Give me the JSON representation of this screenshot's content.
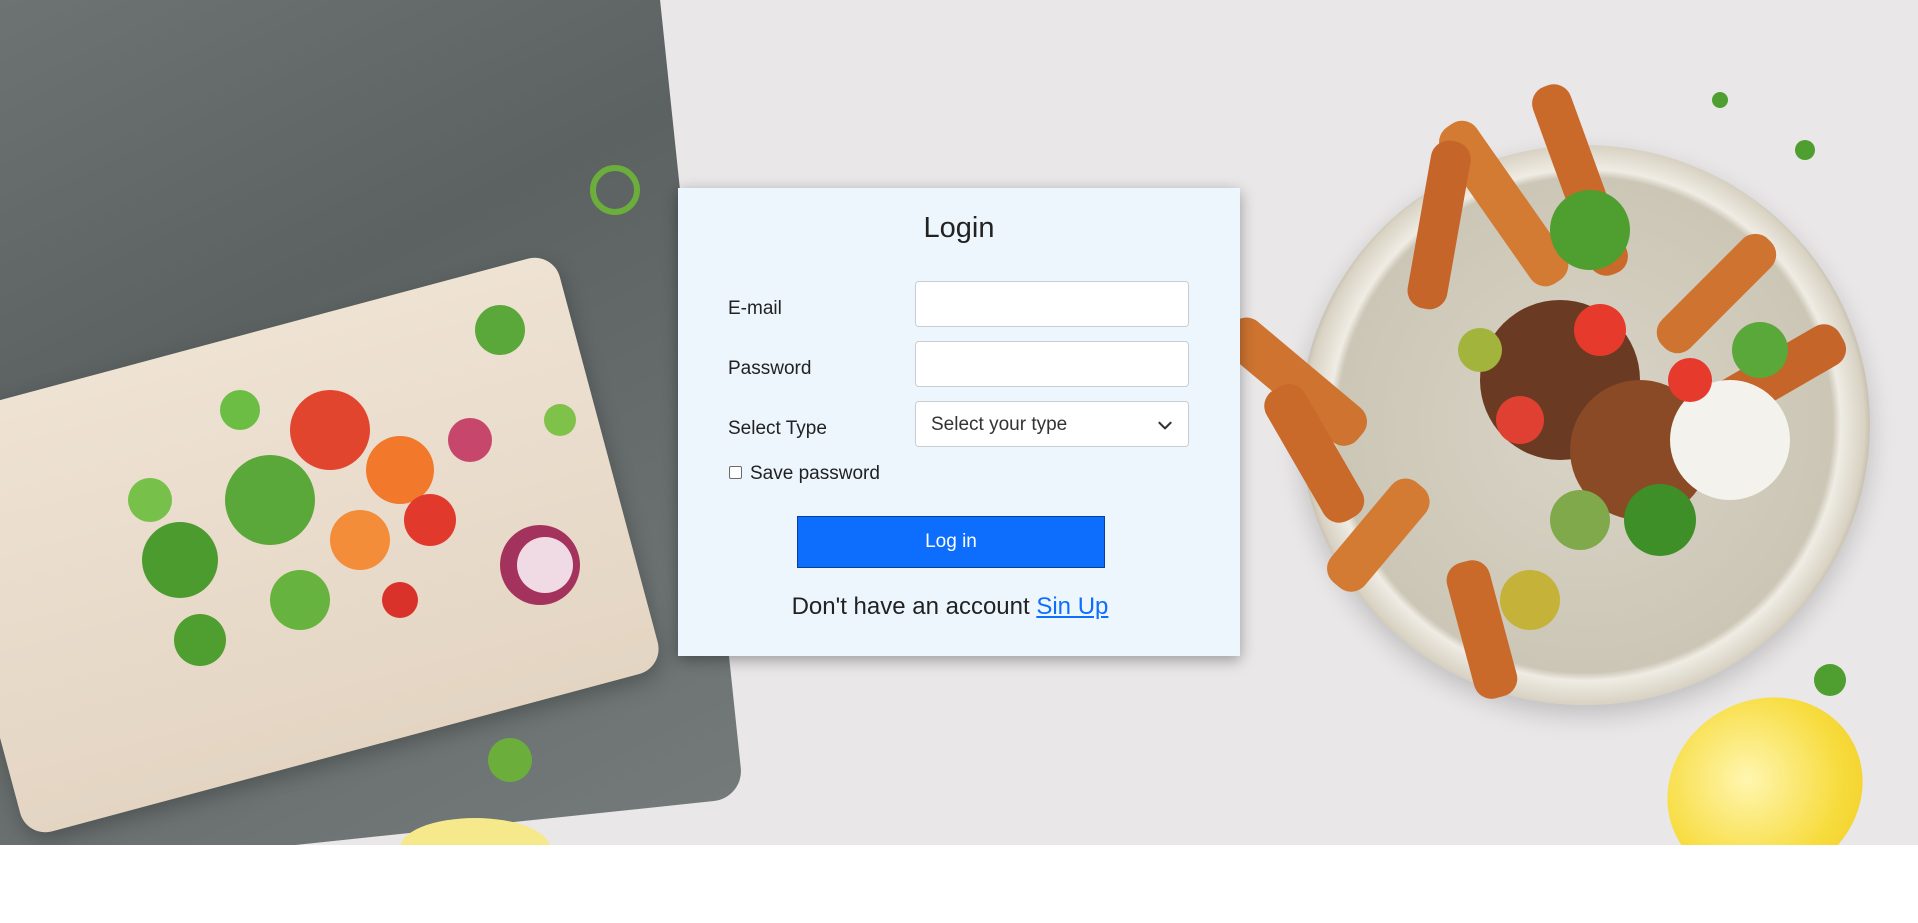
{
  "login": {
    "title": "Login",
    "email_label": "E-mail",
    "email_value": "",
    "password_label": "Password",
    "password_value": "",
    "type_label": "Select Type",
    "type_selected": "Select your type",
    "save_password_label": "Save password",
    "save_password_checked": false,
    "login_button": "Log in",
    "signup_prompt": "Don't have an account",
    "signup_link": "Sin Up"
  },
  "colors": {
    "card_background": "#eef6fd",
    "primary_button": "#0d6efd",
    "link": "#0d6efd"
  },
  "icons": {
    "select_arrow": "chevron-down-icon"
  }
}
